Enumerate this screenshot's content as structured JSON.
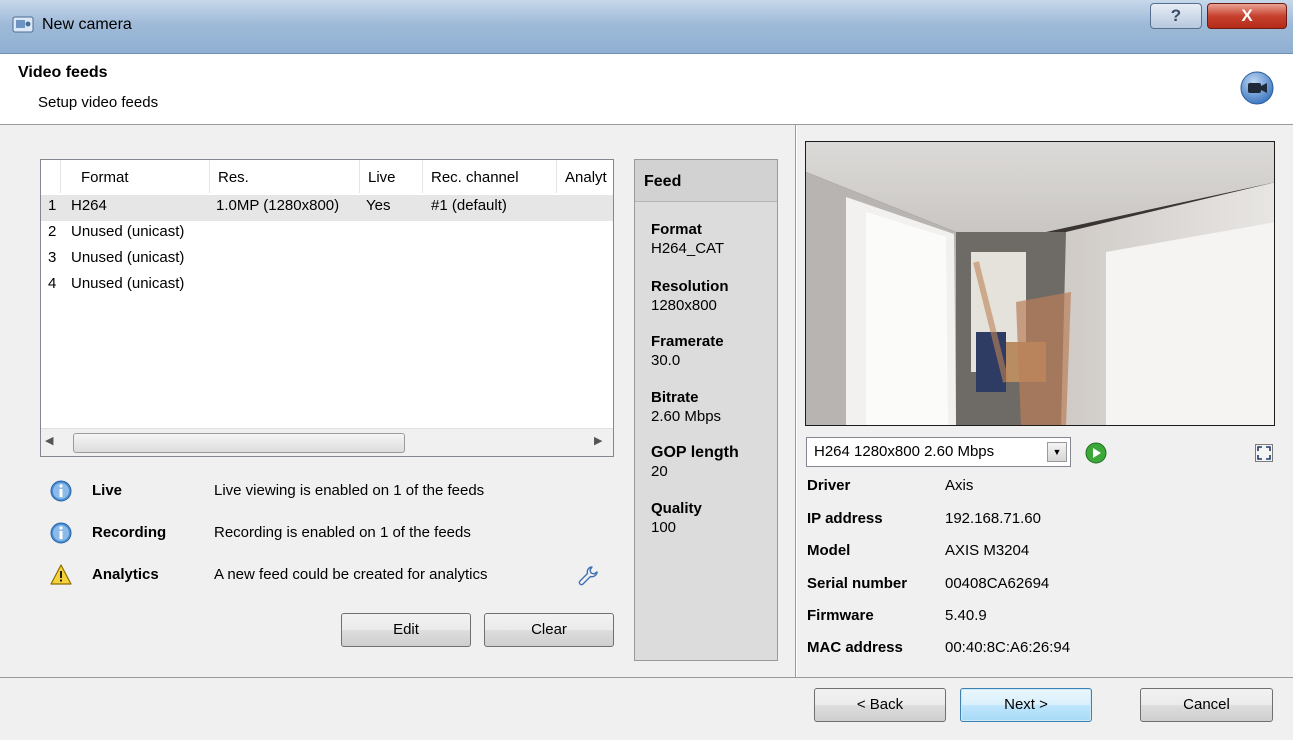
{
  "window": {
    "title": "New camera",
    "help_label": "?",
    "close_label": "X"
  },
  "header": {
    "title": "Video feeds",
    "subtitle": "Setup video feeds",
    "icon": "camera-icon"
  },
  "feeds_table": {
    "columns": [
      "Format",
      "Res.",
      "Live",
      "Rec. channel",
      "Analyt"
    ],
    "rows": [
      {
        "num": "1",
        "format": "H264",
        "res": "1.0MP (1280x800)",
        "live": "Yes",
        "rec": "#1 (default)",
        "selected": true
      },
      {
        "num": "2",
        "format": "Unused (unicast)",
        "res": "",
        "live": "",
        "rec": ""
      },
      {
        "num": "3",
        "format": "Unused (unicast)",
        "res": "",
        "live": "",
        "rec": ""
      },
      {
        "num": "4",
        "format": "Unused (unicast)",
        "res": "",
        "live": "",
        "rec": ""
      }
    ]
  },
  "status": [
    {
      "icon": "info-icon",
      "label": "Live",
      "message": "Live viewing is enabled on 1 of the feeds"
    },
    {
      "icon": "info-icon",
      "label": "Recording",
      "message": "Recording is enabled on 1 of the feeds"
    },
    {
      "icon": "warning-icon",
      "label": "Analytics",
      "message": "A new feed could be created for analytics"
    }
  ],
  "buttons": {
    "edit": "Edit",
    "clear": "Clear",
    "back": "< Back",
    "next": "Next >",
    "cancel": "Cancel"
  },
  "feed_panel": {
    "title": "Feed",
    "fields": [
      {
        "label": "Format",
        "value": "H264_CAT"
      },
      {
        "label": "Resolution",
        "value": "1280x800"
      },
      {
        "label": "Framerate",
        "value": "30.0"
      },
      {
        "label": "Bitrate",
        "value": "2.60 Mbps"
      },
      {
        "label": "GOP length",
        "value": "20"
      },
      {
        "label": "Quality",
        "value": "100"
      }
    ]
  },
  "preview": {
    "stream_select": "H264 1280x800 2.60 Mbps"
  },
  "camera_info": [
    {
      "label": "Driver",
      "value": "Axis"
    },
    {
      "label": "IP address",
      "value": "192.168.71.60"
    },
    {
      "label": "Model",
      "value": "AXIS M3204"
    },
    {
      "label": "Serial number",
      "value": "00408CA62694"
    },
    {
      "label": "Firmware",
      "value": "5.40.9"
    },
    {
      "label": "MAC address",
      "value": "00:40:8C:A6:26:94"
    }
  ],
  "colors": {
    "info_blue": "#4a8fd6",
    "warning_yellow": "#f5d23c",
    "play_green": "#3da83a"
  }
}
